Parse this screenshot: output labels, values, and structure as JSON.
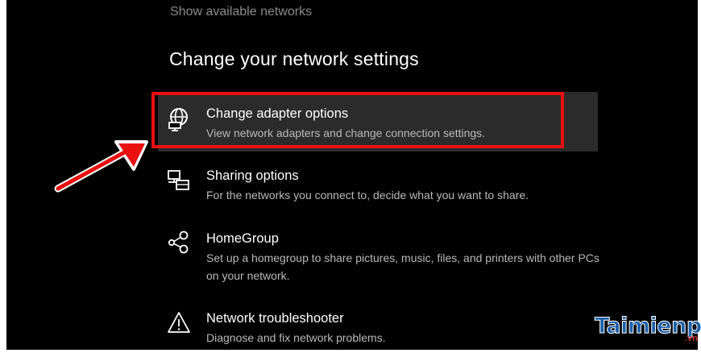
{
  "top_link": "Show available networks",
  "section_title": "Change your network settings",
  "options": [
    {
      "title": "Change adapter options",
      "desc": "View network adapters and change connection settings.",
      "icon": "network-adapter-icon",
      "highlighted": true
    },
    {
      "title": "Sharing options",
      "desc": "For the networks you connect to, decide what you want to share.",
      "icon": "sharing-icon",
      "highlighted": false
    },
    {
      "title": "HomeGroup",
      "desc": "Set up a homegroup to share pictures, music, files, and printers with other PCs on your network.",
      "icon": "homegroup-icon",
      "highlighted": false
    },
    {
      "title": "Network troubleshooter",
      "desc": "Diagnose and fix network problems.",
      "icon": "warning-icon",
      "highlighted": false
    }
  ],
  "watermark": {
    "text": "Taimienphi",
    "suffix": ".vn"
  },
  "colors": {
    "background": "#000000",
    "highlight": "#2b2b2b",
    "callout": "#e81010",
    "watermark": "#1d5fa8"
  }
}
